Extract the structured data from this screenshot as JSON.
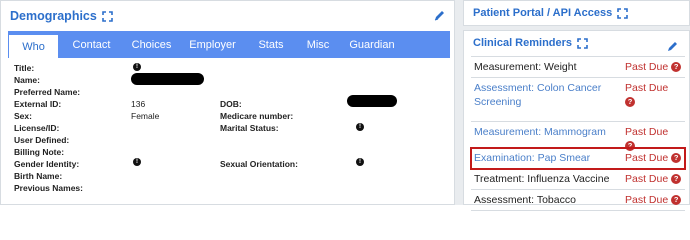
{
  "demographics": {
    "title": "Demographics",
    "tabs": [
      "Who",
      "Contact",
      "Choices",
      "Employer",
      "Stats",
      "Misc",
      "Guardian"
    ],
    "active_tab": "Who",
    "fields": {
      "title": "Title:",
      "name": "Name:",
      "preferred_name": "Preferred Name:",
      "external_id": "External ID:",
      "external_id_value": "136",
      "sex": "Sex:",
      "sex_value": "Female",
      "license": "License/ID:",
      "user_defined": "User Defined:",
      "billing_note": "Billing Note:",
      "gender_identity": "Gender Identity:",
      "birth_name": "Birth Name:",
      "previous_names": "Previous Names:",
      "dob": "DOB:",
      "medicare": "Medicare number:",
      "marital_status": "Marital Status:",
      "sexual_orientation": "Sexual Orientation:"
    },
    "info_glyph": "!"
  },
  "portal": {
    "title": "Patient Portal / API Access"
  },
  "reminders": {
    "title": "Clinical Reminders",
    "question_glyph": "?",
    "items": [
      {
        "name": "Measurement: Weight",
        "status": "Past Due"
      },
      {
        "name": "Assessment: Colon Cancer Screening",
        "status": "Past Due"
      },
      {
        "name": "Measurement: Mammogram",
        "status": "Past Due"
      },
      {
        "name": "Examination: Pap Smear",
        "status": "Past Due"
      },
      {
        "name": "Treatment: Influenza Vaccine",
        "status": "Past Due"
      },
      {
        "name": "Assessment: Tobacco",
        "status": "Past Due"
      }
    ]
  },
  "colors": {
    "accent": "#2c6fcb",
    "tab_bar": "#5b8ef0",
    "past_due": "#c0312f",
    "highlight": "#c21a1a"
  }
}
